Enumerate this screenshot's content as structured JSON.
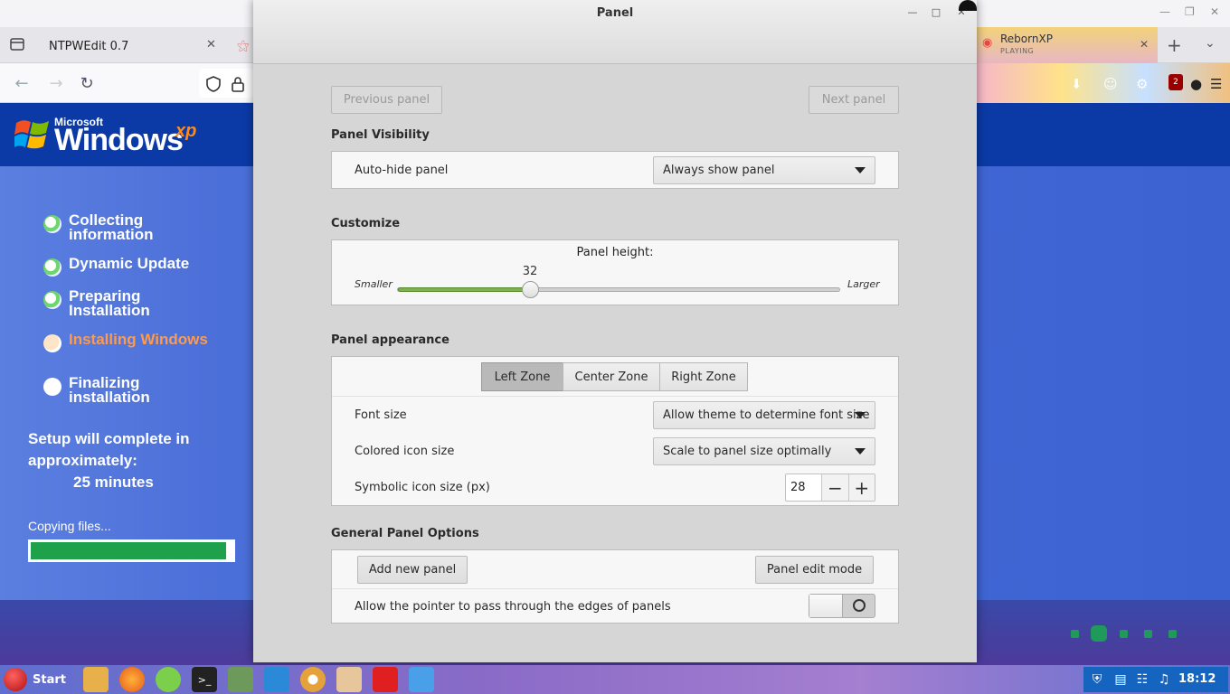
{
  "browser": {
    "tabs": [
      {
        "label": "NTPWEdit 0.7"
      },
      {
        "label": "RebornXP",
        "sublabel": "PLAYING"
      }
    ],
    "icons": {
      "tabs": "tab-list-icon",
      "back": "arrow-left-icon",
      "forward": "arrow-right-icon",
      "reload": "reload-icon",
      "shield": "shield-icon",
      "lock": "lock-icon",
      "new_tab": "plus-icon",
      "tab_menu": "chevron-down-icon",
      "download": "download-icon",
      "extensions": "puzzle-icon",
      "ublock_badge": "2",
      "menu": "hamburger-icon"
    }
  },
  "xp_setup": {
    "logo_brand": "Microsoft",
    "logo_word": "Windows",
    "logo_suffix": "xp",
    "steps": [
      {
        "label": "Collecting information",
        "state": "done"
      },
      {
        "label": "Dynamic Update",
        "state": "done"
      },
      {
        "label": "Preparing Installation",
        "state": "done"
      },
      {
        "label": "Installing Windows",
        "state": "current"
      },
      {
        "label": "Finalizing installation",
        "state": "pending"
      }
    ],
    "remaining_text": "Setup will complete in approximately:",
    "remaining_value": "25 minutes",
    "status_text": "Copying files...",
    "progress": 0.97,
    "progress_color": "#1fa04a"
  },
  "dialog": {
    "title": "Panel",
    "prev_label": "Previous panel",
    "next_label": "Next panel",
    "visibility": {
      "section_title": "Panel Visibility",
      "autohide_label": "Auto-hide panel",
      "autohide_value": "Always show panel"
    },
    "customize": {
      "section_title": "Customize",
      "height_label": "Panel height:",
      "height_value": "32",
      "height_fraction": 0.3,
      "min_label": "Smaller",
      "max_label": "Larger",
      "accent": "#7fb04e"
    },
    "appearance": {
      "section_title": "Panel appearance",
      "zones": [
        {
          "label": "Left Zone",
          "active": true
        },
        {
          "label": "Center Zone",
          "active": false
        },
        {
          "label": "Right Zone",
          "active": false
        }
      ],
      "font_size_label": "Font size",
      "font_size_value": "Allow theme to determine font size",
      "colored_icon_label": "Colored icon size",
      "colored_icon_value": "Scale to panel size optimally",
      "symbolic_icon_label": "Symbolic icon size (px)",
      "symbolic_icon_value": "28",
      "minus": "−",
      "plus": "+"
    },
    "general": {
      "section_title": "General Panel Options",
      "add_label": "Add new panel",
      "edit_label": "Panel edit mode",
      "pointer_label": "Allow the pointer to pass through the edges of panels",
      "pointer_enabled": false
    }
  },
  "taskbar": {
    "start_label": "Start",
    "apps": [
      "folder-icon",
      "firefox-icon",
      "grid-apps-icon",
      "terminal-icon",
      "settings-icon",
      "monitor-icon",
      "disc-icon",
      "package-icon",
      "anydesk-icon",
      "window-icon"
    ],
    "tray": [
      "shield-tray-icon",
      "clipboard-icon",
      "network-icon",
      "music-icon"
    ],
    "clock": "18:12"
  }
}
